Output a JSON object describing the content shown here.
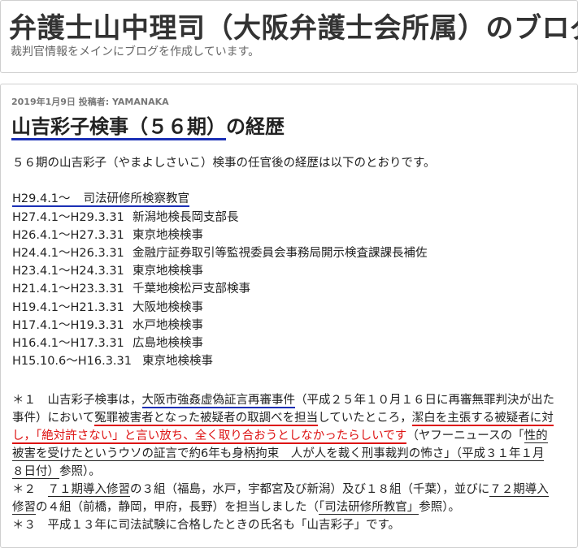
{
  "header": {
    "blog_title": "弁護士山中理司（大阪弁護士会所属）のブログ",
    "description": "裁判官情報をメインにブログを作成しています。"
  },
  "post": {
    "meta": "2019年1月9日 投稿者: YAMANAKA",
    "title_highlight": "山吉彩子検事（５６期）",
    "title_rest": "の経歴",
    "intro": "５６期の山吉彩子（やまよしさいこ）検事の任官後の経歴は以下のとおりです。",
    "career": [
      {
        "period": "H29.4.1～",
        "post": "司法研修所検察教官"
      },
      {
        "period": "H27.4.1～H29.3.31",
        "post": "新潟地検長岡支部長"
      },
      {
        "period": "H26.4.1～H27.3.31",
        "post": "東京地検検事"
      },
      {
        "period": "H24.4.1～H26.3.31",
        "post": "金融庁証券取引等監視委員会事務局開示検査課課長補佐"
      },
      {
        "period": "H23.4.1～H24.3.31",
        "post": "東京地検検事"
      },
      {
        "period": "H21.4.1～H23.3.31",
        "post": "千葉地検松戸支部検事"
      },
      {
        "period": "H19.4.1～H21.3.31",
        "post": "大阪地検検事"
      },
      {
        "period": "H17.4.1～H19.3.31",
        "post": "水戸地検検事"
      },
      {
        "period": "H16.4.1～H17.3.31",
        "post": "広島地検検事"
      },
      {
        "period": "H15.10.6～H16.3.31",
        "post": "東京地検検事"
      }
    ],
    "notes": {
      "n1_a": "＊１　山吉彩子検事は，",
      "n1_b": "大阪市強姦虚偽証言再審事件",
      "n1_c": "（平成２５年１０月１６日に再審無罪判決が出た",
      "n1_d": "事件）において",
      "n1_e": "冤罪被害者となった被疑者の取調べを担当",
      "n1_f": "していたところ，",
      "n1_g": "潔白を主張する被疑者に対",
      "n1_h": "し，「絶対許さない」と言い放ち、全く取り合おうとしなかったらしいです",
      "n1_i": "（ヤフーニュースの「",
      "n1_j": "性的",
      "n1_k": "被害を受けたというウソの証言で約6年も身柄拘束　人が人を裁く刑事裁判の怖さ」（平成３１年１月",
      "n1_l": "８日付）",
      "n1_m": "参照）。",
      "n2_a": "＊２　",
      "n2_b": "７１期導入修習",
      "n2_c": "の３組（福島，水戸，宇都宮及び新潟）及び１８組（千葉），並びに",
      "n2_d": "７２期導入",
      "n2_e": "修習",
      "n2_f": "の４組（前橋，静岡，甲府，長野）を担当しました（",
      "n2_g": "「司法研修所教官」",
      "n2_h": "参照）。",
      "n3": "＊３　平成１３年に司法試験に合格したときの氏名も「山吉彩子」です。"
    }
  },
  "colors": {
    "blue_underline": "#1a2fb5",
    "red": "#d11"
  }
}
